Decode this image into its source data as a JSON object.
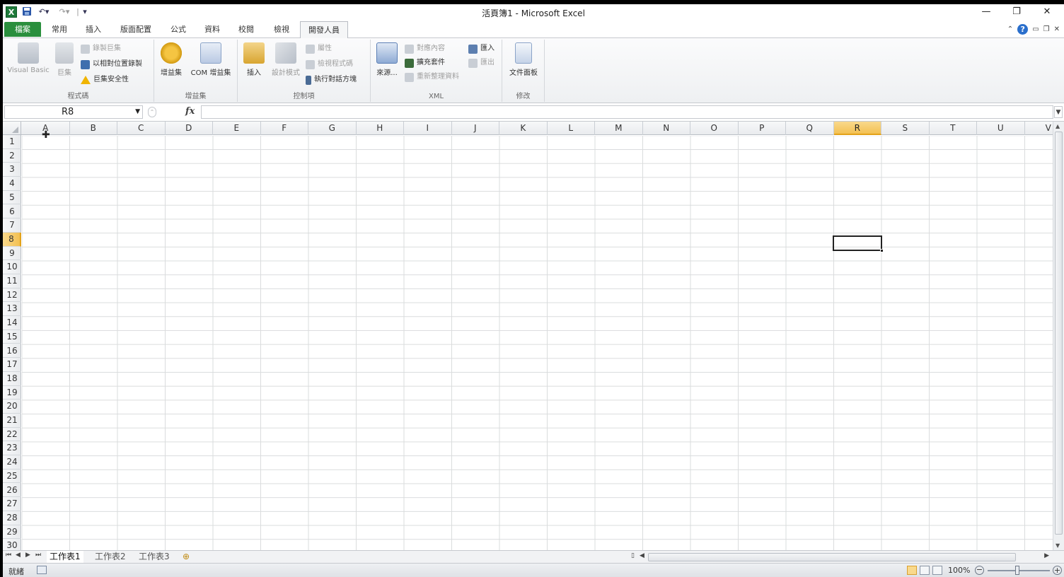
{
  "window": {
    "title": "活頁簿1 - Microsoft Excel",
    "qat_more": "|"
  },
  "tabs": [
    {
      "label": "檔案"
    },
    {
      "label": "常用"
    },
    {
      "label": "插入"
    },
    {
      "label": "版面配置"
    },
    {
      "label": "公式"
    },
    {
      "label": "資料"
    },
    {
      "label": "校閱"
    },
    {
      "label": "檢視"
    },
    {
      "label": "開發人員"
    }
  ],
  "ribbon": {
    "code": {
      "label": "程式碼",
      "visual_basic": "Visual Basic",
      "macros": "巨集",
      "record_macro": "錄製巨集",
      "relative_ref": "以相對位置錄製",
      "macro_security": "巨集安全性"
    },
    "addins": {
      "label": "增益集",
      "addins": "增益集",
      "com_addins": "COM 增益集"
    },
    "controls": {
      "label": "控制項",
      "insert": "插入",
      "design_mode": "設計模式",
      "properties": "屬性",
      "view_code": "檢視程式碼",
      "run_dialog": "執行對話方塊"
    },
    "xml": {
      "label": "XML",
      "source": "來源...",
      "map_properties": "對應內容",
      "expansion_packs": "擴充套件",
      "refresh_data": "重新整理資料",
      "import": "匯入",
      "export": "匯出"
    },
    "modify": {
      "label": "修改",
      "document_panel": "文件面板"
    }
  },
  "formula_bar": {
    "name_box": "R8",
    "fx": "fx",
    "value": ""
  },
  "columns": [
    "A",
    "B",
    "C",
    "D",
    "E",
    "F",
    "G",
    "H",
    "I",
    "J",
    "K",
    "L",
    "M",
    "N",
    "O",
    "P",
    "Q",
    "R",
    "S",
    "T",
    "U",
    "V"
  ],
  "rows": [
    "1",
    "2",
    "3",
    "4",
    "5",
    "6",
    "7",
    "8",
    "9",
    "10",
    "11",
    "12",
    "13",
    "14",
    "15",
    "16",
    "17",
    "18",
    "19",
    "20",
    "21",
    "22",
    "23",
    "24",
    "25",
    "26",
    "27",
    "28",
    "29",
    "30"
  ],
  "selected": {
    "column": "R",
    "row": "8"
  },
  "sheets": [
    {
      "label": "工作表1",
      "active": true
    },
    {
      "label": "工作表2",
      "active": false
    },
    {
      "label": "工作表3",
      "active": false
    }
  ],
  "status": {
    "text": "就緒",
    "zoom": "100%"
  },
  "colors": {
    "file_tab": "#2a8f3d",
    "selection_header": "#f3c052"
  }
}
